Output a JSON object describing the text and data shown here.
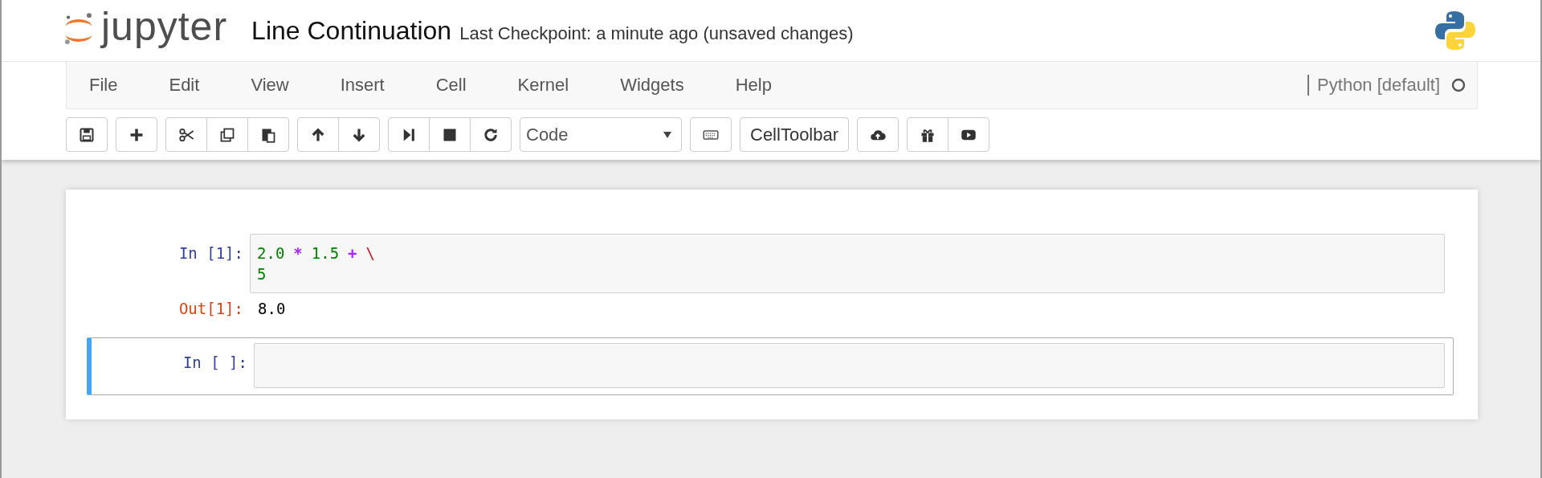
{
  "header": {
    "logo_text": "jupyter",
    "notebook_name": "Line Continuation",
    "checkpoint": "Last Checkpoint: a minute ago (unsaved changes)"
  },
  "menu": [
    "File",
    "Edit",
    "View",
    "Insert",
    "Cell",
    "Kernel",
    "Widgets",
    "Help"
  ],
  "kernel": {
    "name": "Python [default]",
    "busy": false
  },
  "toolbar": {
    "cell_type": "Code",
    "celltoolbar": "CellToolbar"
  },
  "cells": [
    {
      "prompt": "In [1]:",
      "selected": false,
      "lines": [
        [
          {
            "kind": "number",
            "text": "2.0"
          },
          {
            "kind": "operator",
            "text": "*"
          },
          {
            "kind": "number",
            "text": "1.5"
          },
          {
            "kind": "operator",
            "text": "+"
          },
          {
            "kind": "escape",
            "text": "\\"
          }
        ],
        [
          {
            "kind": "number",
            "text": "5"
          }
        ]
      ],
      "output_prompt": "Out[1]:",
      "output": "8.0"
    },
    {
      "prompt": "In [ ]:",
      "selected": true
    }
  ]
}
